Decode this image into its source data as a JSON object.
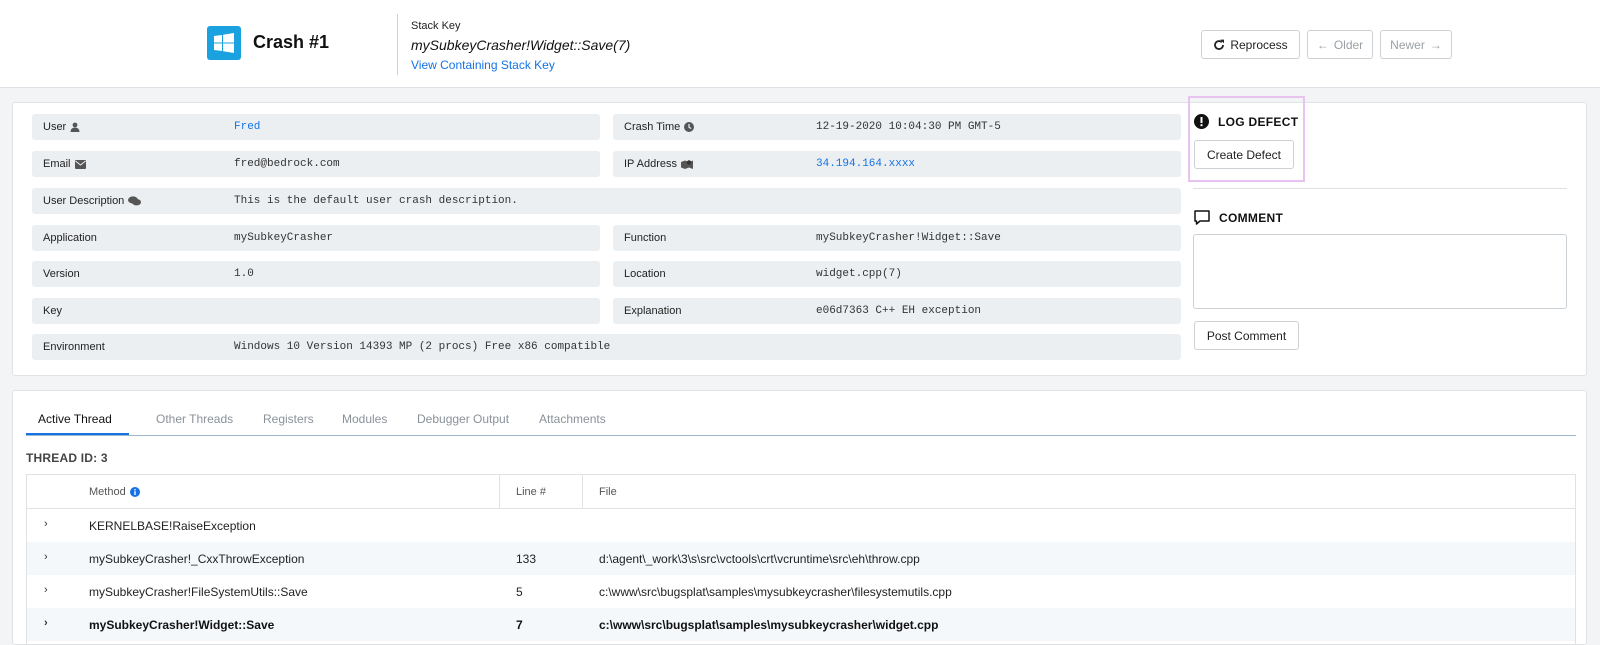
{
  "header": {
    "title": "Crash #1",
    "stack_key_label": "Stack Key",
    "stack_key_value": "mySubkeyCrasher!Widget::Save(7)",
    "view_stack_key_link": "View Containing Stack Key",
    "reprocess_label": "Reprocess",
    "older_label": "Older",
    "newer_label": "Newer"
  },
  "details": {
    "user_label": "User",
    "user_value": "Fred",
    "crash_time_label": "Crash Time",
    "crash_time_value": "12-19-2020 10:04:30 PM GMT-5",
    "email_label": "Email",
    "email_value": "fred@bedrock.com",
    "ip_label": "IP Address",
    "ip_value": "34.194.164.xxxx",
    "user_description_label": "User Description",
    "user_description_value": "This is the default user crash description.",
    "application_label": "Application",
    "application_value": "mySubkeyCrasher",
    "function_label": "Function",
    "function_value": "mySubkeyCrasher!Widget::Save",
    "version_label": "Version",
    "version_value": "1.0",
    "location_label": "Location",
    "location_value": "widget.cpp(7)",
    "key_label": "Key",
    "key_value": "",
    "explanation_label": "Explanation",
    "explanation_value": "e06d7363 C++ EH exception",
    "environment_label": "Environment",
    "environment_value": "Windows 10 Version 14393 MP (2 procs) Free x86 compatible"
  },
  "panel": {
    "log_defect_heading": "LOG DEFECT",
    "create_defect_label": "Create Defect",
    "comment_heading": "COMMENT",
    "comment_placeholder": "",
    "post_comment_label": "Post Comment"
  },
  "tabs": [
    {
      "label": "Active Thread"
    },
    {
      "label": "Other Threads"
    },
    {
      "label": "Registers"
    },
    {
      "label": "Modules"
    },
    {
      "label": "Debugger Output"
    },
    {
      "label": "Attachments"
    }
  ],
  "thread_id": "THREAD ID: 3",
  "table": {
    "headers": {
      "method": "Method",
      "line": "Line #",
      "file": "File"
    },
    "rows": [
      {
        "method": "KERNELBASE!RaiseException",
        "line": "",
        "file": ""
      },
      {
        "method": "mySubkeyCrasher!_CxxThrowException",
        "line": "133",
        "file": "d:\\agent\\_work\\3\\s\\src\\vctools\\crt\\vcruntime\\src\\eh\\throw.cpp"
      },
      {
        "method": "mySubkeyCrasher!FileSystemUtils::Save",
        "line": "5",
        "file": "c:\\www\\src\\bugsplat\\samples\\mysubkeycrasher\\filesystemutils.cpp"
      },
      {
        "method": "mySubkeyCrasher!Widget::Save",
        "line": "7",
        "file": "c:\\www\\src\\bugsplat\\samples\\mysubkeycrasher\\widget.cpp"
      }
    ]
  },
  "colors": {
    "accent": "#1473e6",
    "windows_logo": "#1aa1e0",
    "highlight_outline": "#e8c3f0"
  }
}
